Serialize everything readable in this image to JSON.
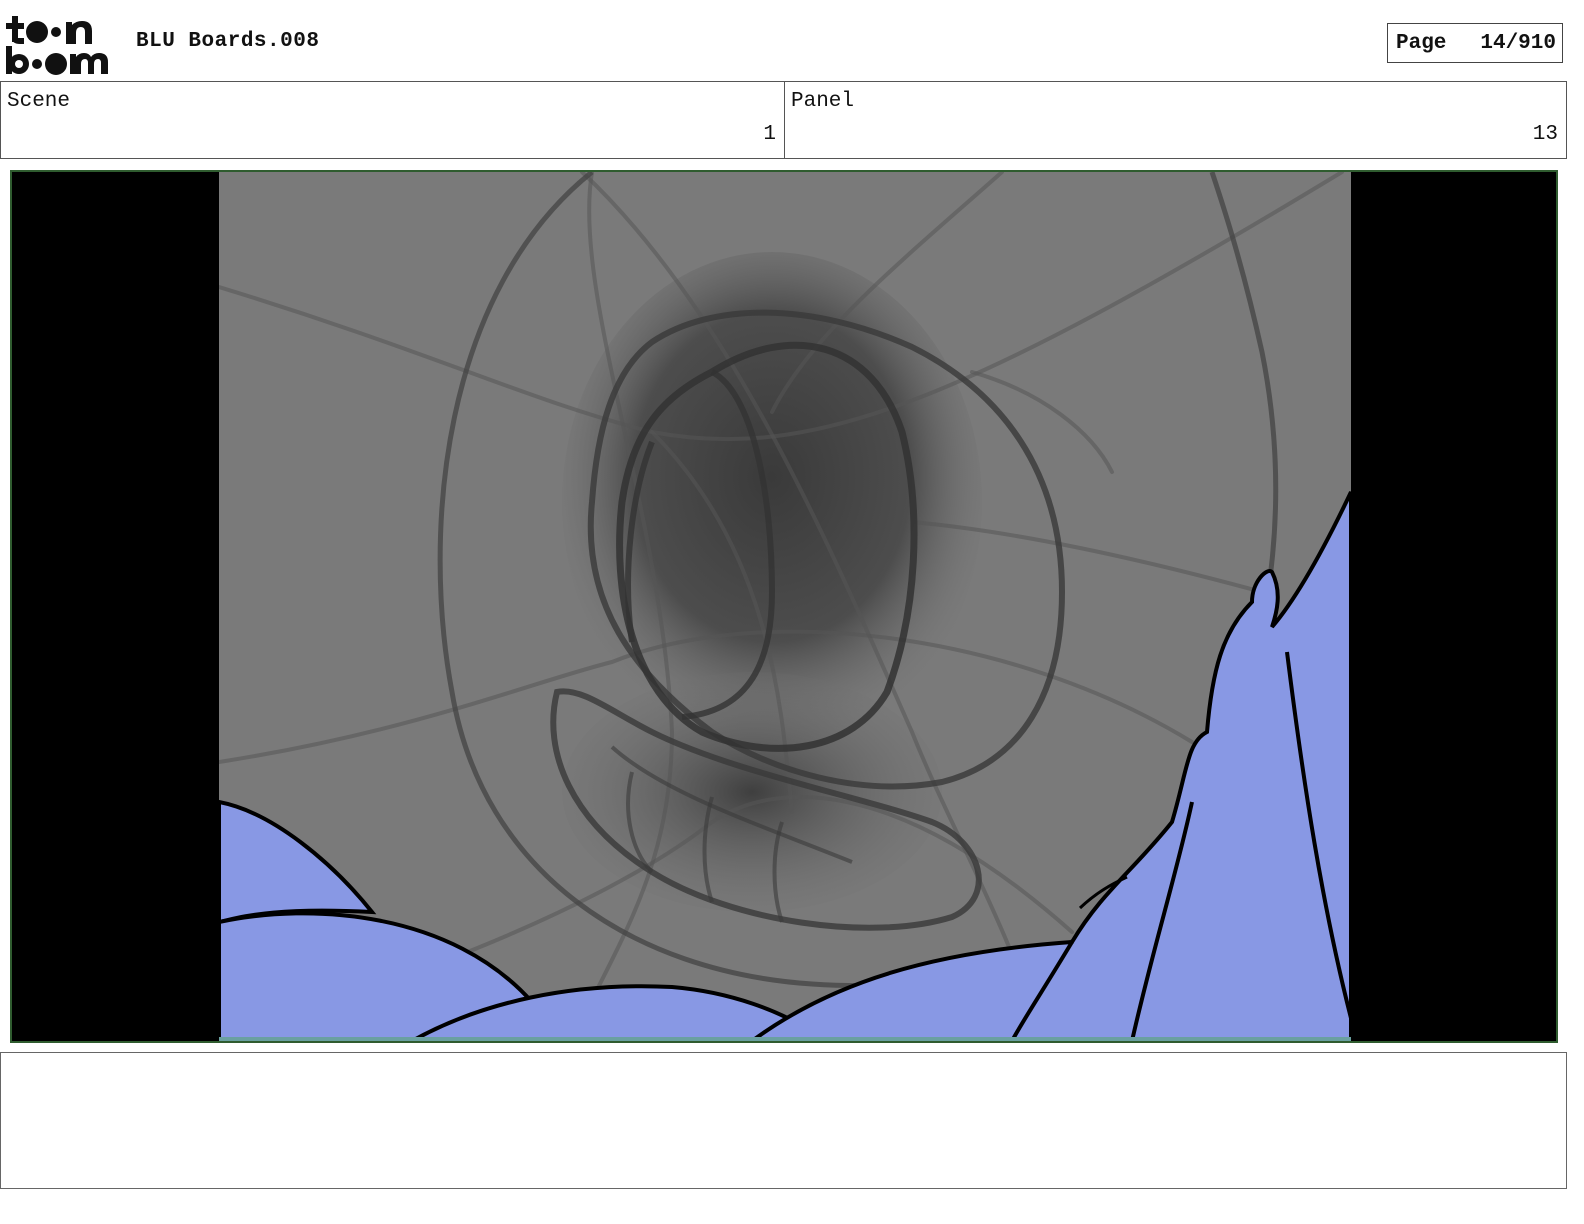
{
  "header": {
    "logo_text_top": "toon",
    "logo_text_bottom": "boom",
    "title": "BLU Boards.008",
    "page_label": "Page",
    "page_value": "14/910"
  },
  "info": {
    "scene_label": "Scene",
    "scene_value": "1",
    "panel_label": "Panel",
    "panel_value": "13"
  },
  "colors": {
    "letterbox": "#000000",
    "sketch_bg": "#7a7a7a",
    "character_blue": "#8898e4",
    "frame_border": "#2f5c2f"
  },
  "notes": {
    "text": ""
  }
}
